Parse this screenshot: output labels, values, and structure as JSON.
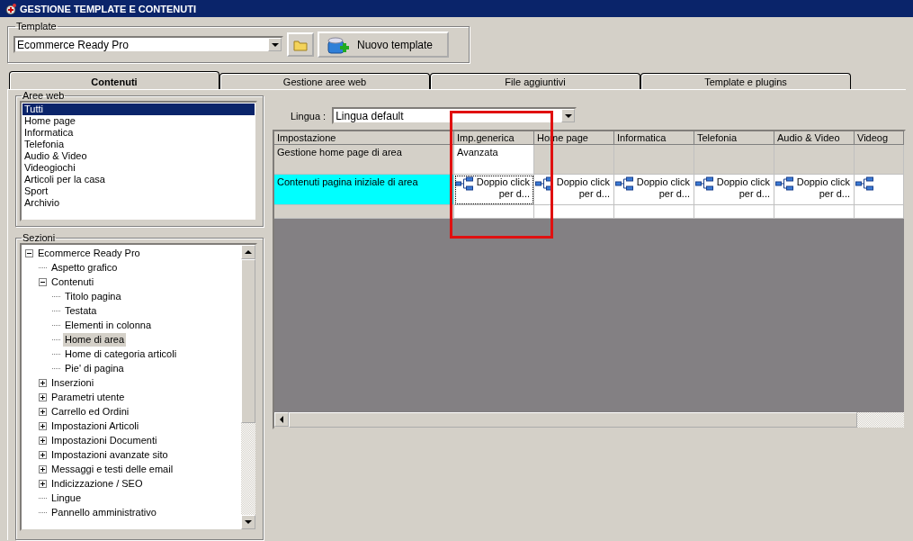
{
  "window": {
    "title": "GESTIONE TEMPLATE E CONTENUTI"
  },
  "template_group": {
    "label": "Template",
    "value": "Ecommerce Ready Pro",
    "new_button": "Nuovo template"
  },
  "tabs": [
    {
      "label": "Contenuti",
      "selected": true
    },
    {
      "label": "Gestione aree web",
      "selected": false
    },
    {
      "label": "File aggiuntivi",
      "selected": false
    },
    {
      "label": "Template e plugins",
      "selected": false
    }
  ],
  "aree_web": {
    "label": "Aree web",
    "items": [
      {
        "label": "Tutti",
        "selected": true
      },
      {
        "label": "Home page",
        "selected": false
      },
      {
        "label": "Informatica",
        "selected": false
      },
      {
        "label": "Telefonia",
        "selected": false
      },
      {
        "label": "Audio & Video",
        "selected": false
      },
      {
        "label": "Videogiochi",
        "selected": false
      },
      {
        "label": "Articoli per la casa",
        "selected": false
      },
      {
        "label": "Sport",
        "selected": false
      },
      {
        "label": "Archivio",
        "selected": false
      }
    ]
  },
  "sezioni": {
    "label": "Sezioni",
    "tree": [
      {
        "label": "Ecommerce Ready Pro",
        "selected": false,
        "expanded": true,
        "children": [
          {
            "label": "Aspetto grafico",
            "selected": false
          },
          {
            "label": "Contenuti",
            "selected": false,
            "expanded": true,
            "children": [
              {
                "label": "Titolo pagina",
                "selected": false
              },
              {
                "label": "Testata",
                "selected": false
              },
              {
                "label": "Elementi in colonna",
                "selected": false
              },
              {
                "label": "Home di area",
                "selected": true
              },
              {
                "label": "Home di categoria articoli",
                "selected": false
              },
              {
                "label": "Pie' di pagina",
                "selected": false
              }
            ]
          },
          {
            "label": "Inserzioni",
            "selected": false,
            "expanded": false
          },
          {
            "label": "Parametri utente",
            "selected": false,
            "expanded": false
          },
          {
            "label": "Carrello ed Ordini",
            "selected": false,
            "expanded": false
          },
          {
            "label": "Impostazioni Articoli",
            "selected": false,
            "expanded": false
          },
          {
            "label": "Impostazioni Documenti",
            "selected": false,
            "expanded": false
          },
          {
            "label": "Impostazioni avanzate sito",
            "selected": false,
            "expanded": false
          },
          {
            "label": "Messaggi e testi delle email",
            "selected": false,
            "expanded": false
          },
          {
            "label": "Indicizzazione / SEO",
            "selected": false,
            "expanded": false
          },
          {
            "label": "Lingue",
            "selected": false
          },
          {
            "label": "Pannello amministrativo",
            "selected": false
          }
        ]
      }
    ]
  },
  "lingua": {
    "label": "Lingua :",
    "value": "Lingua default"
  },
  "grid": {
    "columns": [
      "Impostazione",
      "Imp.generica",
      "Home page",
      "Informatica",
      "Telefonia",
      "Audio & Video",
      "Videog"
    ],
    "rows": [
      {
        "selected": false,
        "cells": [
          {
            "kind": "label",
            "text": "Gestione home page di area"
          },
          {
            "kind": "value",
            "text": "Avanzata"
          },
          {
            "kind": "blank"
          },
          {
            "kind": "blank"
          },
          {
            "kind": "blank"
          },
          {
            "kind": "blank"
          },
          {
            "kind": "blank"
          }
        ]
      },
      {
        "selected": true,
        "cells": [
          {
            "kind": "label",
            "text": "Contenuti pagina iniziale di area"
          },
          {
            "kind": "link",
            "text": "Doppio click per d..."
          },
          {
            "kind": "link",
            "text": "Doppio click per d..."
          },
          {
            "kind": "link",
            "text": "Doppio click per d..."
          },
          {
            "kind": "link",
            "text": "Doppio click per d..."
          },
          {
            "kind": "link",
            "text": "Doppio click per d..."
          },
          {
            "kind": "link"
          }
        ]
      },
      {
        "selected": false,
        "cells": [
          {
            "kind": "label"
          },
          {
            "kind": "value"
          },
          {
            "kind": "value"
          },
          {
            "kind": "value"
          },
          {
            "kind": "value"
          },
          {
            "kind": "value"
          },
          {
            "kind": "value"
          }
        ]
      }
    ]
  }
}
